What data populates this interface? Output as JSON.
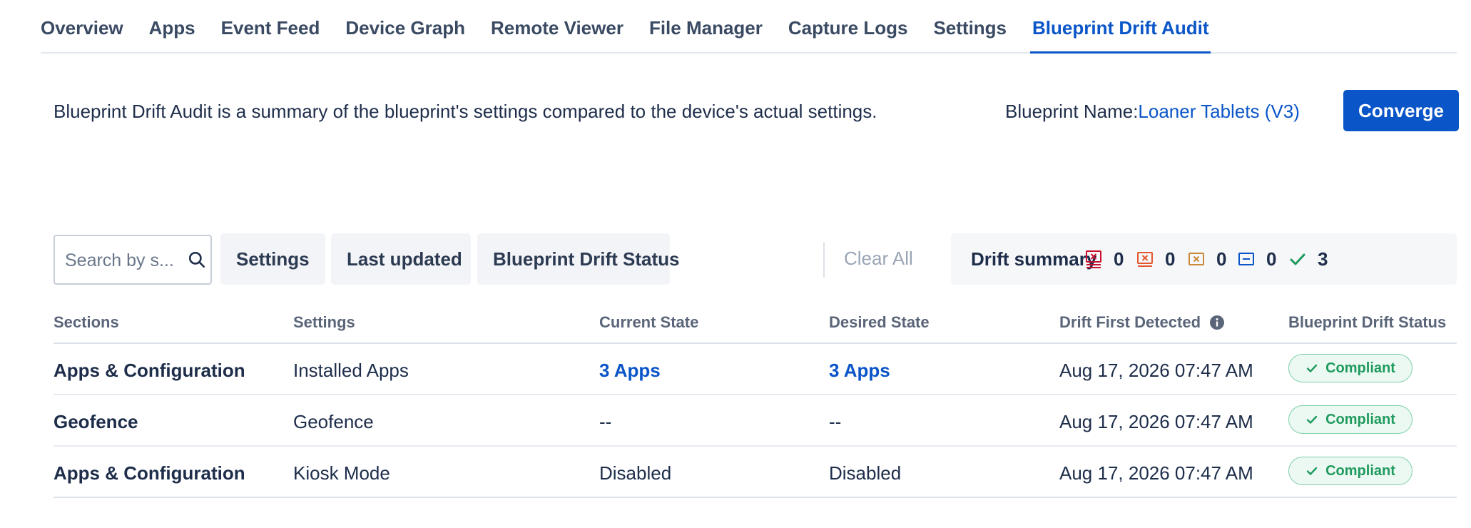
{
  "tabs": [
    {
      "label": "Overview"
    },
    {
      "label": "Apps"
    },
    {
      "label": "Event Feed"
    },
    {
      "label": "Device Graph"
    },
    {
      "label": "Remote Viewer"
    },
    {
      "label": "File Manager"
    },
    {
      "label": "Capture Logs"
    },
    {
      "label": "Settings"
    },
    {
      "label": "Blueprint Drift Audit"
    }
  ],
  "active_tab": "Blueprint Drift Audit",
  "description": "Blueprint Drift Audit is a summary of the blueprint's settings compared to the device's actual settings.",
  "blueprint": {
    "label": "Blueprint Name:",
    "name": "Loaner Tablets (V3)"
  },
  "converge_label": "Converge",
  "filters": {
    "search_placeholder": "Search by s...",
    "settings_label": "Settings",
    "last_updated_label": "Last updated",
    "drift_status_label": "Blueprint Drift Status",
    "clear_all_label": "Clear All"
  },
  "drift_summary": {
    "label": "Drift summary",
    "items": [
      {
        "icon": "critical-drift-icon",
        "count": "0",
        "color": "#c8102e"
      },
      {
        "icon": "high-drift-icon",
        "count": "0",
        "color": "#e4572e"
      },
      {
        "icon": "medium-drift-icon",
        "count": "0",
        "color": "#c98a3a"
      },
      {
        "icon": "low-drift-icon",
        "count": "0",
        "color": "#0a55c8"
      },
      {
        "icon": "compliant-check-icon",
        "count": "3",
        "color": "#1f9a5e"
      }
    ]
  },
  "table": {
    "headers": {
      "sections": "Sections",
      "settings": "Settings",
      "current": "Current State",
      "desired": "Desired State",
      "detected": "Drift First Detected",
      "status": "Blueprint Drift Status"
    },
    "rows": [
      {
        "section": "Apps & Configuration",
        "setting": "Installed Apps",
        "current": "3 Apps",
        "desired": "3 Apps",
        "detected": "Aug 17, 2026 07:47 AM",
        "status": "Compliant"
      },
      {
        "section": "Geofence",
        "setting": "Geofence",
        "current": "--",
        "desired": "--",
        "detected": "Aug 17, 2026 07:47 AM",
        "status": "Compliant"
      },
      {
        "section": "Apps & Configuration",
        "setting": "Kiosk Mode",
        "current": "Disabled",
        "desired": "Disabled",
        "detected": "Aug 17, 2026 07:47 AM",
        "status": "Compliant"
      }
    ]
  },
  "colors": {
    "accent": "#0a55c8",
    "compliant": "#1f9a5e"
  }
}
